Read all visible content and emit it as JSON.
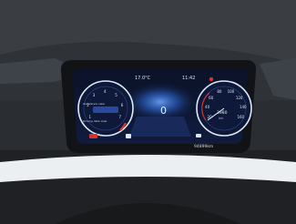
{
  "header": {
    "outside_temp": "17.0°C",
    "time": "11:42"
  },
  "gear_indicator": "0",
  "odometer": "94899km",
  "trip_display": {
    "value": "3980",
    "unit": "km"
  },
  "left_gauge": {
    "ticks": [
      "1",
      "2",
      "3",
      "4",
      "5",
      "6",
      "7"
    ],
    "line1": "Assistance view",
    "line2": "Driving data view"
  },
  "right_gauge": {
    "ticks": [
      "20",
      "40",
      "60",
      "80",
      "100",
      "120",
      "140",
      "160"
    ]
  },
  "colors": {
    "screen_bg": "#0c1430",
    "accent_red": "#d8322a",
    "gauge_ring": "#dfe9f7",
    "glow_blue": "#2f6bd8"
  },
  "icons": [
    "warning-red-icon",
    "assist-car-icon",
    "fuel-icon",
    "battery-icon",
    "temperature-icon"
  ]
}
